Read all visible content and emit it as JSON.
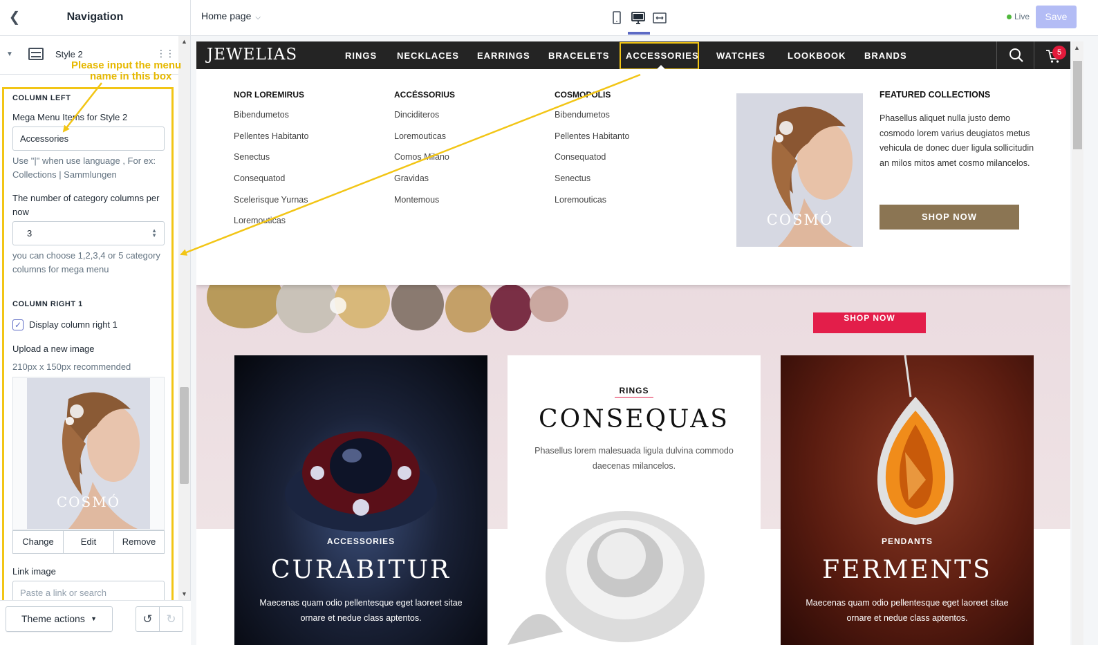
{
  "sidebar": {
    "title": "Navigation",
    "section_label": "Style 2",
    "hint_text_line1": "Please input the menu",
    "hint_text_line2": "name in this box",
    "col_left_heading": "COLUMN LEFT",
    "mega_items_label": "Mega Menu Items for Style 2",
    "mega_items_value": "Accessories",
    "mega_items_help": "Use \"|\" when use language , For ex: Collections | Sammlungen",
    "columns_label": "The number of category columns per now",
    "columns_value": "3",
    "columns_help": "you can choose 1,2,3,4 or 5 category columns for mega menu",
    "col_right_heading": "COLUMN RIGHT 1",
    "display_right_label": "Display column right 1",
    "display_right_checked": true,
    "upload_label": "Upload a new image",
    "upload_help": "210px x 150px recommended",
    "image_caption": "COSMÓ",
    "image_buttons": [
      "Change",
      "Edit",
      "Remove"
    ],
    "link_label": "Link image",
    "link_placeholder": "Paste a link or search",
    "theme_actions": "Theme actions"
  },
  "topbar": {
    "page_select": "Home page",
    "live_label": "Live",
    "save_label": "Save"
  },
  "store": {
    "logo": "JEWELIAS",
    "nav": [
      "RINGS",
      "NECKLACES",
      "EARRINGS",
      "BRACELETS",
      "ACCESSORIES",
      "WATCHES",
      "LOOKBOOK",
      "BRANDS"
    ],
    "active_nav": "ACCESSORIES",
    "cart_count": "5",
    "mega_menu": {
      "columns": [
        {
          "title": "NOR LOREMIRUS",
          "items": [
            "Bibendumetos",
            "Pellentes Habitanto",
            "Senectus",
            "Consequatod",
            "Scelerisque Yurnas",
            "Loremouticas"
          ]
        },
        {
          "title": "ACCÉSSORIUS",
          "items": [
            "Dinciditeros",
            "Loremouticas",
            "Comos Milano",
            "Gravidas",
            "Montemous"
          ]
        },
        {
          "title": "COSMOPOLIS",
          "items": [
            "Bibendumetos",
            "Pellentes Habitanto",
            "Consequatod",
            "Senectus",
            "Loremouticas"
          ]
        }
      ],
      "image_caption": "COSMÓ",
      "featured_title": "FEATURED COLLECTIONS",
      "featured_text": "Phasellus aliquet nulla justo demo cosmodo lorem varius deugiatos metus vehicula de donec duer ligula sollicitudin an milos mitos amet cosmo milancelos.",
      "shop_now": "SHOP NOW"
    },
    "hero_shop_now": "SHOP NOW",
    "cards": [
      {
        "tag": "ACCESSORIES",
        "title": "CURABITUR",
        "text": "Maecenas quam odio pellentesque eget laoreet sitae ornare et nedue class aptentos."
      },
      {
        "tag": "RINGS",
        "title": "CONSEQUAS",
        "text": "Phasellus lorem malesuada ligula dulvina commodo daecenas milancelos."
      },
      {
        "tag": "PENDANTS",
        "title": "FERMENTS",
        "text": "Maecenas quam odio pellentesque eget laoreet sitae ornare et nedue class aptentos."
      }
    ]
  },
  "colors": {
    "highlight": "#f2c515",
    "accent": "#5c6ac4",
    "shop_btn": "#8b7553",
    "hero_btn": "#e31e4a",
    "badge": "#e41a3b"
  }
}
